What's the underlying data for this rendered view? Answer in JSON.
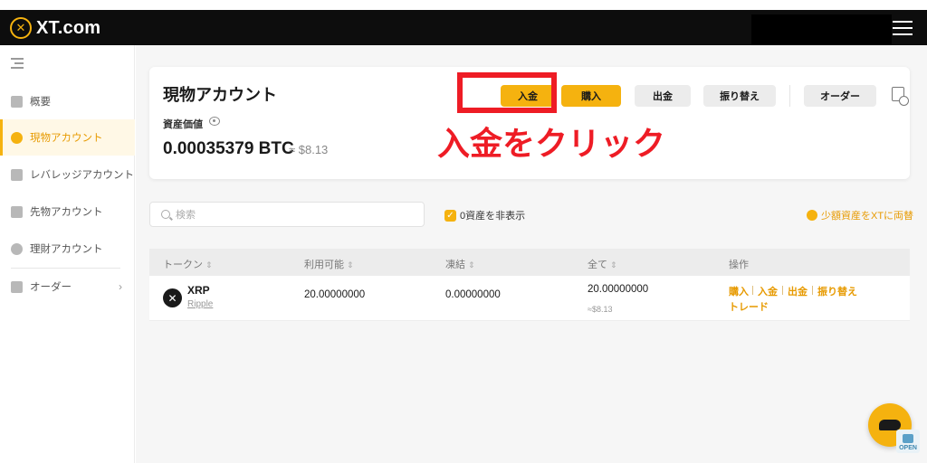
{
  "brand": {
    "logo_mark": "✕",
    "logo_text": "XT.com"
  },
  "sidebar": {
    "items": [
      {
        "label": "概要",
        "icon": "overview-icon"
      },
      {
        "label": "現物アカウント",
        "icon": "pie-chart-icon",
        "active": true
      },
      {
        "label": "レバレッジアカウント",
        "icon": "sliders-icon"
      },
      {
        "label": "先物アカウント",
        "icon": "futures-icon"
      },
      {
        "label": "理財アカウント",
        "icon": "earn-icon"
      },
      {
        "label": "オーダー",
        "icon": "order-icon"
      }
    ]
  },
  "account": {
    "title": "現物アカウント",
    "asset_label": "資産価値",
    "btc_value": "0.00035379 BTC",
    "fiat_value": "≈ $8.13"
  },
  "actions": {
    "deposit": "入金",
    "buy": "購入",
    "withdraw": "出金",
    "transfer": "振り替え",
    "order": "オーダー"
  },
  "annotation": {
    "text": "入金をクリック",
    "color": "#ee1c25"
  },
  "search": {
    "placeholder": "検索"
  },
  "filters": {
    "hide_zero_label": "0資産を非表示",
    "hide_zero_checked": true,
    "convert_label": "少額資産をXTに両替"
  },
  "table": {
    "headers": [
      "トークン",
      "利用可能",
      "凍結",
      "全て",
      "操作"
    ],
    "rows": [
      {
        "symbol": "XRP",
        "name": "Ripple",
        "available": "20.00000000",
        "frozen": "0.00000000",
        "total": "20.00000000",
        "total_fiat": "≈$8.13",
        "actions": [
          "購入",
          "入金",
          "出金",
          "振り替え",
          "トレード"
        ]
      }
    ]
  },
  "colors": {
    "brand_yellow": "#f5b20f",
    "accent_orange": "#e79a00",
    "annotation_red": "#ee1c25",
    "topbar": "#0d0d0d"
  },
  "floating": {
    "open_badge": "OPEN"
  }
}
